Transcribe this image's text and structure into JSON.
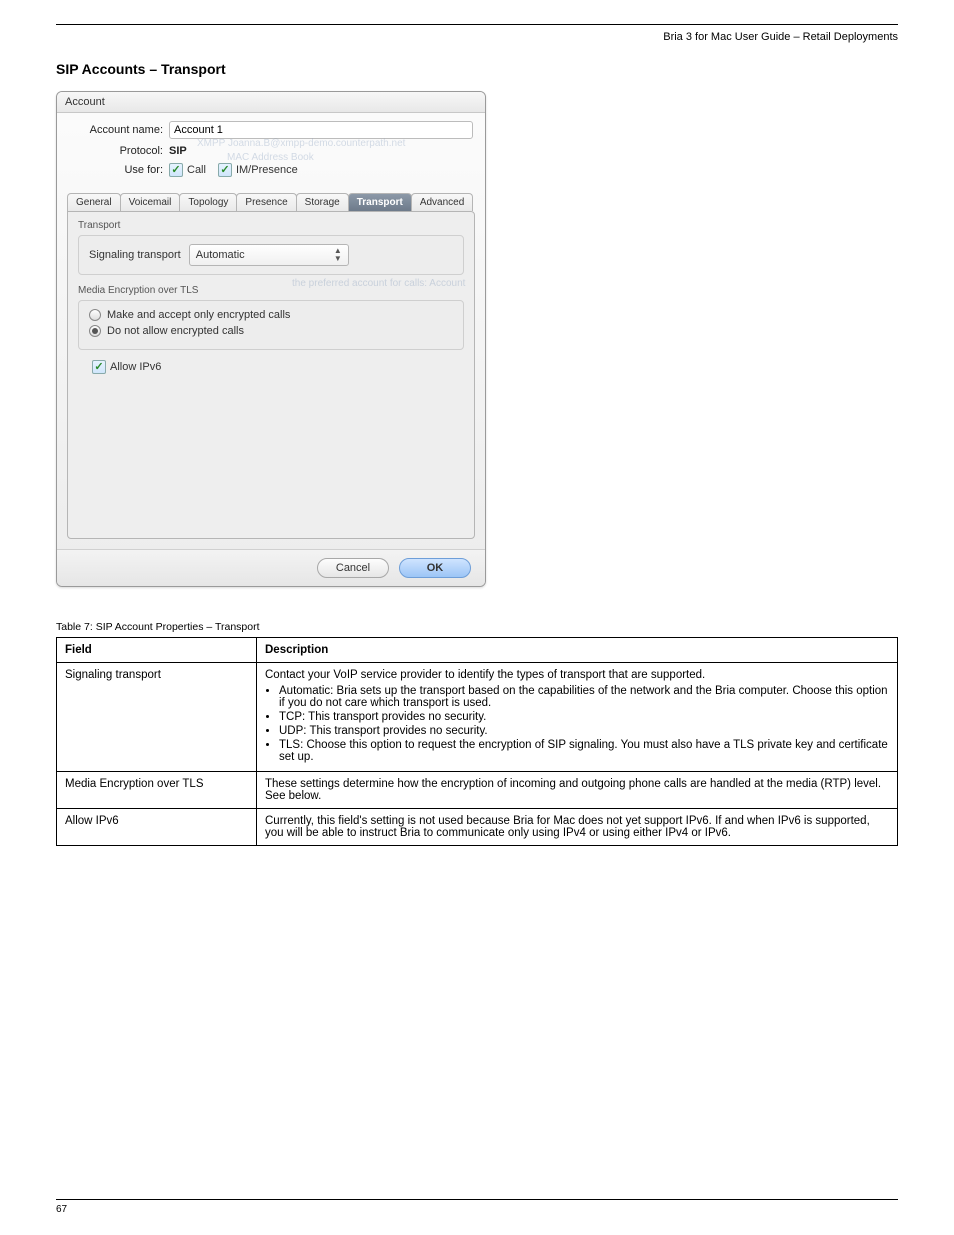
{
  "header": {
    "right": "Bria 3 for Mac User Guide – Retail Deployments"
  },
  "section_title": "SIP Accounts – Transport",
  "window": {
    "title": "Account",
    "account_name_label": "Account name:",
    "account_name_value": "Account 1",
    "protocol_label": "Protocol:",
    "protocol_value": "SIP",
    "use_for_label": "Use for:",
    "use_for_call": "Call",
    "use_for_im": "IM/Presence",
    "tabs": [
      "General",
      "Voicemail",
      "Topology",
      "Presence",
      "Storage",
      "Transport",
      "Advanced"
    ],
    "active_tab_index": 5,
    "transport_group": "Transport",
    "signaling_label": "Signaling transport",
    "signaling_value": "Automatic",
    "media_group": "Media Encryption over TLS",
    "radio1": "Make and accept only encrypted calls",
    "radio2": "Do not allow encrypted calls",
    "radio_selected": 1,
    "allow_ipv6": "Allow IPv6",
    "cancel": "Cancel",
    "ok": "OK",
    "ghost": {
      "g1": "XMPP Joanna.B@xmpp-demo.counterpath.net",
      "g2": "MAC Address Book",
      "g3": "the preferred account for calls: Account"
    }
  },
  "table": {
    "caption": "Table 7: SIP Account Properties – Transport",
    "head_field": "Field",
    "head_desc": "Description",
    "rows": [
      {
        "field": "Signaling transport",
        "desc_intro": "Contact your VoIP service provider to identify the types of transport that are supported.",
        "bullets": [
          "Automatic: Bria sets up the transport based on the capabilities of the network and the Bria computer. Choose this option if you do not care which transport is used.",
          "TCP: This transport provides no security.",
          "UDP: This transport provides no security.",
          "TLS: Choose this option to request the encryption of SIP signaling. You must also have a TLS private key and certificate set up."
        ]
      },
      {
        "field": "Media Encryption over TLS",
        "desc_plain": "These settings determine how the encryption of incoming and outgoing phone calls are handled at the media (RTP) level. See below."
      },
      {
        "field": "Allow IPv6",
        "desc_plain": "Currently, this field's setting is not used because Bria for Mac does not yet support IPv6. If and when IPv6 is supported, you will be able to instruct Bria to communicate only using IPv4 or using either IPv4 or IPv6."
      }
    ]
  },
  "footer": {
    "page": "67"
  }
}
